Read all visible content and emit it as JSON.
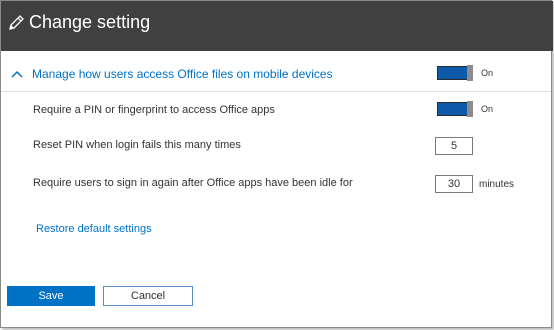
{
  "dialog": {
    "title": "Change setting",
    "pencil_icon": "pencil-icon"
  },
  "section": {
    "title": "Manage how users access Office files on mobile devices",
    "expanded": true,
    "toggle_state": "On",
    "toggle_on": true
  },
  "settings": {
    "require_pin": {
      "label": "Require a PIN or fingerprint to access Office apps",
      "toggle_state": "On",
      "on": true
    },
    "reset_pin": {
      "label": "Reset PIN when login fails this many times",
      "value": "5"
    },
    "idle_signin": {
      "label": "Require users to sign in again after Office apps have been idle for",
      "value": "30",
      "units": "minutes"
    }
  },
  "links": {
    "restore": "Restore default settings"
  },
  "buttons": {
    "save": "Save",
    "cancel": "Cancel"
  },
  "colors": {
    "header_bg": "#404040",
    "accent": "#0072c6",
    "toggle_on": "#0f5aa8"
  }
}
